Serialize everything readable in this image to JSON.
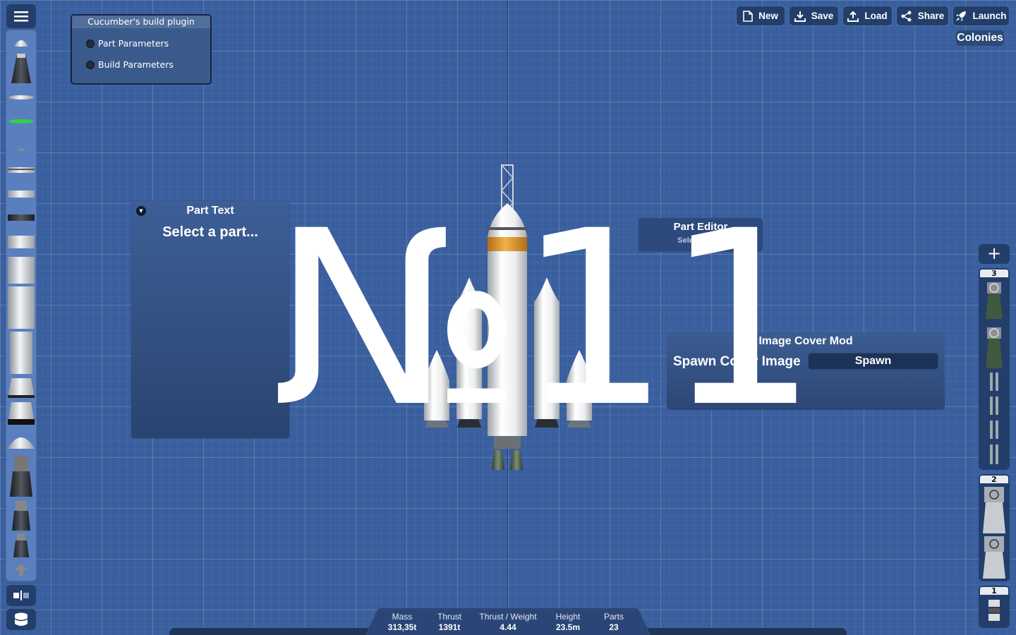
{
  "plugin": {
    "title": "Cucumber's build plugin",
    "items": [
      {
        "label": "Part Parameters"
      },
      {
        "label": "Build Parameters"
      }
    ]
  },
  "toolbar": {
    "new_label": "New",
    "save_label": "Save",
    "load_label": "Load",
    "share_label": "Share",
    "launch_label": "Launch",
    "colonies_label": "Colonies"
  },
  "part_text": {
    "title": "Part Text",
    "placeholder": "Select a part..."
  },
  "part_editor": {
    "title": "Part Editor",
    "placeholder": "Select a part"
  },
  "image_cover": {
    "title": "Image Cover Mod",
    "label": "Spawn Cover Image",
    "button": "Spawn"
  },
  "staging": {
    "add_icon": "plus-icon",
    "stages": [
      {
        "number": "3"
      },
      {
        "number": "2"
      },
      {
        "number": "1"
      }
    ]
  },
  "stats": [
    {
      "label": "Mass",
      "value": "313,35t"
    },
    {
      "label": "Thrust",
      "value": "1391t"
    },
    {
      "label": "Thrust / Weight",
      "value": "4.44"
    },
    {
      "label": "Height",
      "value": "23.5m"
    },
    {
      "label": "Parts",
      "value": "23"
    }
  ],
  "overlay_text": "№11",
  "colors": {
    "background": "#3a5f9e",
    "panel": "#2c4a7c",
    "button": "#233e6a",
    "fairing_orange": "#e8a030"
  }
}
